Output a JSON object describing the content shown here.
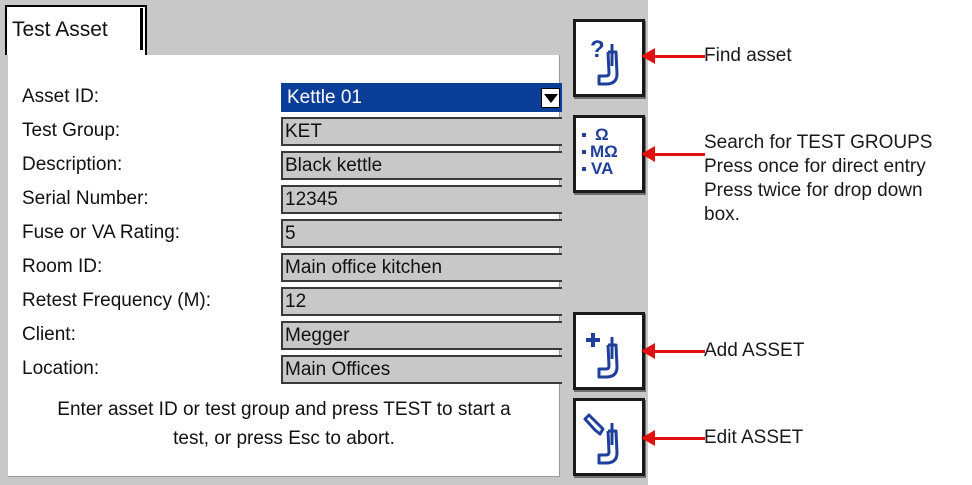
{
  "tab": {
    "label": "Test Asset"
  },
  "form": {
    "fields": [
      {
        "label": "Asset ID:",
        "value": "Kettle 01"
      },
      {
        "label": "Test Group:",
        "value": "KET"
      },
      {
        "label": "Description:",
        "value": "Black kettle"
      },
      {
        "label": "Serial Number:",
        "value": "12345"
      },
      {
        "label": "Fuse or VA Rating:",
        "value": "5"
      },
      {
        "label": "Room ID:",
        "value": "Main office kitchen"
      },
      {
        "label": "Retest Frequency (M):",
        "value": "12"
      },
      {
        "label": "Client:",
        "value": "Megger"
      },
      {
        "label": "Location:",
        "value": "Main Offices"
      }
    ],
    "hint_line1": "Enter asset ID or test group and press TEST to start a",
    "hint_line2": "test, or press Esc to abort."
  },
  "buttons": [
    {
      "icon": "find-asset-icon",
      "glyph": "?",
      "callout": [
        "Find asset"
      ]
    },
    {
      "icon": "test-groups-icon",
      "glyph_lines": [
        "• Ω",
        "• MΩ",
        "• VA"
      ],
      "callout": [
        "Search for TEST GROUPS",
        "Press once for direct entry",
        "Press twice for drop down",
        "box."
      ]
    },
    {
      "icon": "add-asset-icon",
      "glyph": "+",
      "callout": [
        "Add ASSET"
      ]
    },
    {
      "icon": "edit-asset-icon",
      "glyph": "pencil",
      "callout": [
        "Edit ASSET"
      ]
    }
  ],
  "colors": {
    "panel": "#c8c8c8",
    "selected": "#0b3e98",
    "arrow": "#e01010",
    "icon": "#1f3f9a"
  }
}
